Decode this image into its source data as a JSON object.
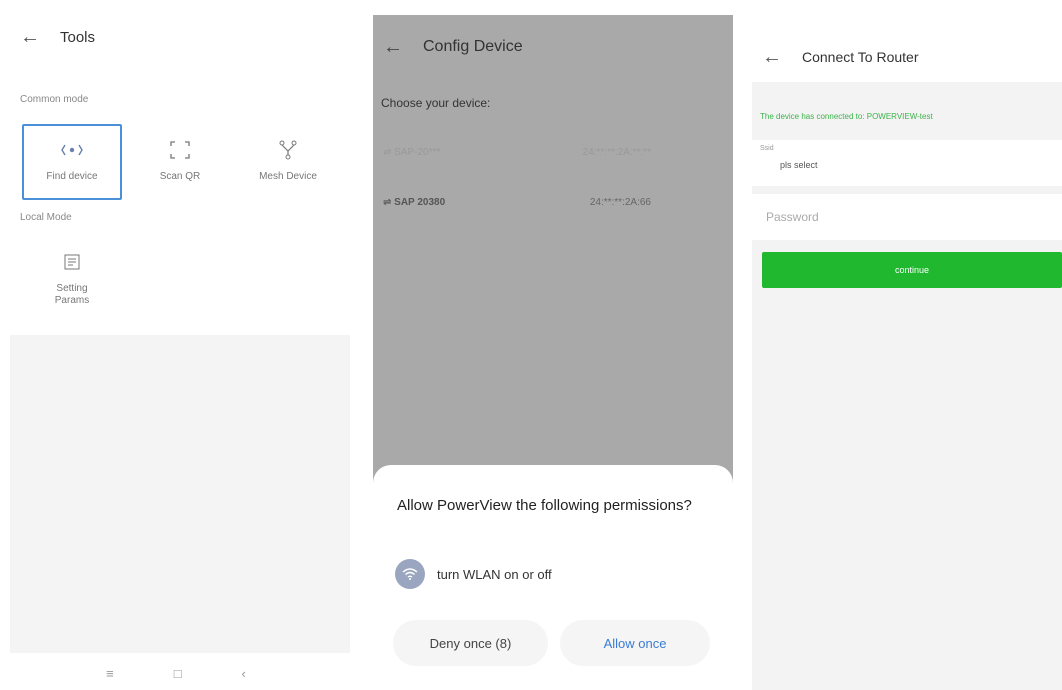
{
  "tools_screen": {
    "title": "Tools",
    "back_icon": "arrow-left-icon",
    "common_mode_label": "Common mode",
    "local_mode_label": "Local Mode",
    "common_tiles": [
      {
        "label": "Find device",
        "icon": "broadcast-icon",
        "selected": true
      },
      {
        "label": "Scan QR",
        "icon": "scan-frame-icon",
        "selected": false
      },
      {
        "label": "Mesh Device",
        "icon": "mesh-network-icon",
        "selected": false
      }
    ],
    "local_tiles": [
      {
        "label": "Setting\nParams",
        "icon": "settings-sheet-icon"
      }
    ],
    "nav_icons": [
      "menu-icon",
      "home-icon",
      "back-nav-icon"
    ]
  },
  "config_screen": {
    "title": "Config Device",
    "choose_label": "Choose your device:",
    "devices": [
      {
        "name": "⇌ SAP-20***",
        "mac": "24:**:**:2A:**:**",
        "faint": true
      },
      {
        "name": "⇌ SAP 20380",
        "mac": "24:**:**:2A:66",
        "faint": false
      }
    ],
    "dialog": {
      "question": "Allow PowerView the following permissions?",
      "permission": "turn WLAN on or off",
      "deny_label": "Deny once (8)",
      "allow_label": "Allow once"
    }
  },
  "router_screen": {
    "title": "Connect To Router",
    "notice": "The device has connected to: POWERVIEW-test",
    "ssid_caption": "Ssid",
    "ssid_value": "pls select",
    "password_placeholder": "Password",
    "continue_label": "continue"
  },
  "colors": {
    "accent_blue": "#3a7bd5",
    "green": "#1fb82f",
    "overlay_gray": "#a9a9a9"
  }
}
